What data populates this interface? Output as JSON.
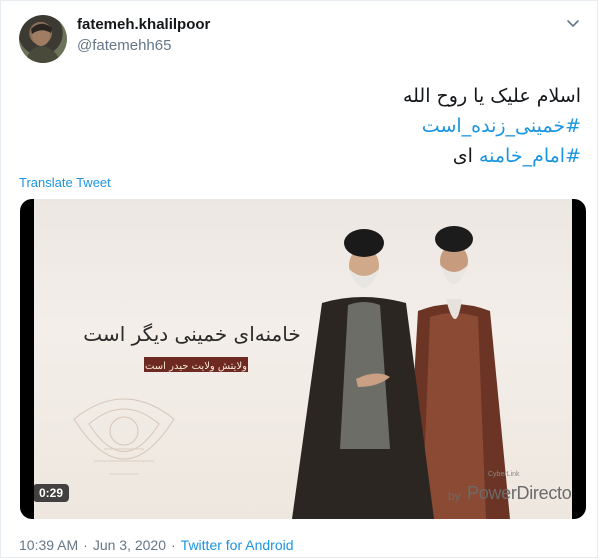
{
  "user": {
    "display_name": "fatemeh.khalilpoor",
    "handle": "@fatemehh65"
  },
  "tweet": {
    "line1": "اسلام علیک یا روح الله",
    "hashtag1": "#خمینی_زنده_است",
    "hashtag2": "#امام_خامنه",
    "line3_suffix": "ای"
  },
  "translate_label": "Translate Tweet",
  "media": {
    "duration": "0:29",
    "calligraphy": "خامنه‌ای خمینی دیگر است",
    "subtitle": "ولایتش ولایت حیدر است",
    "watermark_small": "CyberLink",
    "watermark_by": "by",
    "watermark_main": "PowerDirector"
  },
  "footer": {
    "time": "10:39 AM",
    "separator": "·",
    "date": "Jun 3, 2020",
    "source": "Twitter for Android"
  },
  "icons": {
    "caret": "chevron-down-icon"
  },
  "colors": {
    "link": "#1b95e0",
    "secondary_text": "#657786"
  }
}
